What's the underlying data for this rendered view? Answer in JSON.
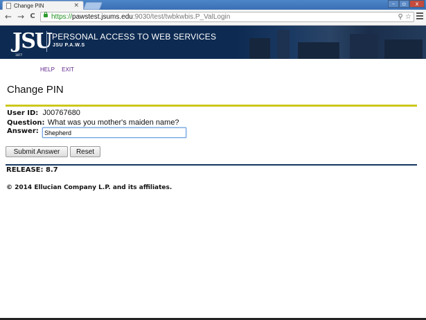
{
  "browser": {
    "tab_title": "Change PIN",
    "tab_close": "×",
    "window_controls": {
      "minimize": "–",
      "maximize": "▫",
      "close": "x"
    },
    "url": {
      "scheme": "https://",
      "host": "pawstest.jsums.edu",
      "path": ":9030/test/twbkwbis.P_ValLogin"
    },
    "nav": {
      "back": "←",
      "forward": "→",
      "reload": "C"
    },
    "omnibox_icons": {
      "search": "⚲",
      "star": "☆"
    }
  },
  "banner": {
    "logo": "JSU",
    "logo_year": "1877",
    "title": "PERSONAL ACCESS TO WEB SERVICES",
    "subtitle": "JSU P.A.W.S"
  },
  "links": {
    "help": "HELP",
    "exit": "EXIT"
  },
  "page": {
    "title": "Change PIN",
    "user_id_label": "User ID:",
    "user_id_value": "J00767680",
    "question_label": "Question:",
    "question_value": "What was you mother's maiden name?",
    "answer_label": "Answer:",
    "answer_value": "Shepherd",
    "submit_label": "Submit Answer",
    "reset_label": "Reset",
    "release": "RELEASE: 8.7",
    "copyright": "© 2014 Ellucian Company L.P. and its affiliates."
  },
  "colors": {
    "banner_bg": "#0d2a52",
    "rule_yellow": "#cdc61a",
    "rule_blue": "#12365e",
    "link": "#5b1f86",
    "url_scheme": "#1f8f1f"
  }
}
